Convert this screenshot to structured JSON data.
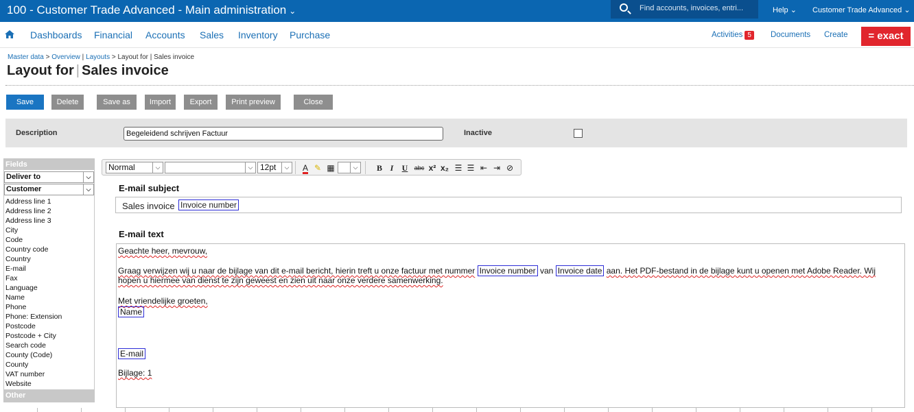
{
  "topbar": {
    "app_title": "100 - Customer Trade Advanced - Main administration",
    "search_placeholder": "Find accounts, invoices, entri...",
    "help_label": "Help",
    "company_label": "Customer Trade Advanced"
  },
  "nav": {
    "items": [
      "Dashboards",
      "Financial",
      "Accounts",
      "Sales",
      "Inventory",
      "Purchase"
    ],
    "activities_label": "Activities",
    "activities_count": "5",
    "documents_label": "Documents",
    "create_label": "Create",
    "logo_text": "= exact"
  },
  "breadcrumb": {
    "master_data": "Master data",
    "overview": "Overview",
    "layouts": "Layouts",
    "current": "Layout for | Sales invoice"
  },
  "page": {
    "title_prefix": "Layout for",
    "title_main": "Sales invoice"
  },
  "toolbar": {
    "save": "Save",
    "delete": "Delete",
    "save_as": "Save as",
    "import": "Import",
    "export": "Export",
    "print_preview": "Print preview",
    "close": "Close"
  },
  "description": {
    "label": "Description",
    "value": "Begeleidend schrijven Factuur",
    "inactive_label": "Inactive",
    "inactive_checked": false
  },
  "fields": {
    "header": "Fields",
    "deliver_to": "Deliver to",
    "customer": "Customer",
    "items": [
      "Address line 1",
      "Address line 2",
      "Address line 3",
      "City",
      "Code",
      "Country code",
      "Country",
      "E-mail",
      "Fax",
      "Language",
      "Name",
      "Phone",
      "Phone: Extension",
      "Postcode",
      "Postcode + City",
      "Search code",
      "County (Code)",
      "County",
      "VAT number",
      "Website"
    ],
    "other_header": "Other"
  },
  "editor": {
    "style": "Normal",
    "font": "",
    "size": "12pt"
  },
  "email": {
    "subject_label": "E-mail subject",
    "subject_text": "Sales invoice",
    "subject_tag": "Invoice number",
    "text_label": "E-mail text",
    "greeting": "Geachte heer, mevrouw,",
    "para1_a": "Graag verwijzen wij u naar de bijlage van dit e-mail bericht, hierin treft u onze factuur met nummer",
    "tag_invoice_number": "Invoice number",
    "para1_van": "van",
    "tag_invoice_date": "Invoice date",
    "para1_b": "aan. Het PDF-bestand in de bijlage kunt u openen met Adobe Reader. Wij",
    "para1_c": "hopen u hiermee van dienst te zijn geweest en zien uit naar onze verdere samenwerking.",
    "closing": "Met vriendelijke groeten,",
    "tag_name": "Name",
    "tag_email": "E-mail",
    "attachment": "Bijlage: 1"
  }
}
